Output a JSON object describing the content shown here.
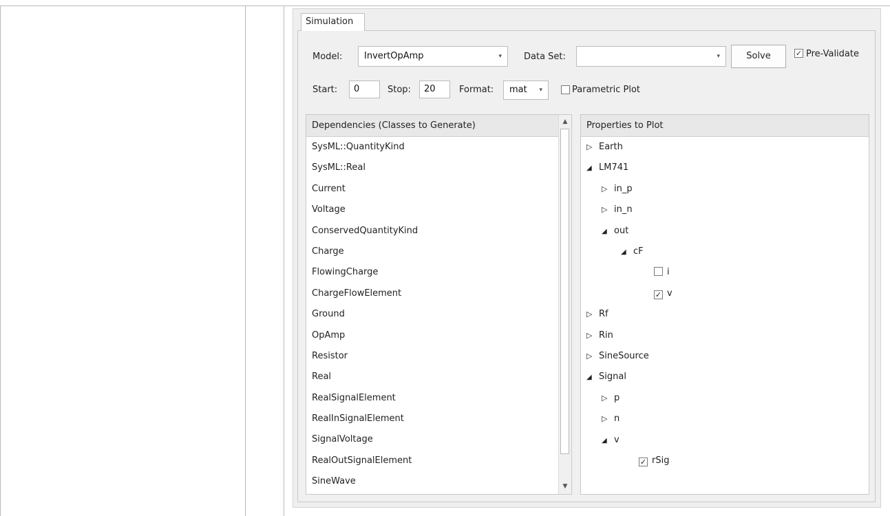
{
  "tab": {
    "label": "Simulation"
  },
  "model": {
    "label": "Model:",
    "value": "InvertOpAmp"
  },
  "dataset": {
    "label": "Data Set:",
    "value": ""
  },
  "solve_label": "Solve",
  "prevalidate": {
    "label": "Pre-Validate",
    "checked": true
  },
  "start": {
    "label": "Start:",
    "value": "0"
  },
  "stop": {
    "label": "Stop:",
    "value": "20"
  },
  "format": {
    "label": "Format:",
    "value": "mat"
  },
  "parametric": {
    "label": "Parametric Plot",
    "checked": false
  },
  "dependencies": {
    "header": "Dependencies (Classes to Generate)",
    "items": [
      "SysML::QuantityKind",
      "SysML::Real",
      "Current",
      "Voltage",
      "ConservedQuantityKind",
      "Charge",
      "FlowingCharge",
      "ChargeFlowElement",
      "Ground",
      "OpAmp",
      "Resistor",
      "Real",
      "RealSignalElement",
      "RealInSignalElement",
      "SignalVoltage",
      "RealOutSignalElement",
      "SineWave"
    ]
  },
  "properties": {
    "header": "Properties to Plot",
    "items": [
      {
        "label": "Earth",
        "state": "collapsed",
        "checked": null
      },
      {
        "label": "LM741",
        "state": "expanded",
        "checked": null
      },
      {
        "label": "in_p",
        "state": "collapsed",
        "checked": null
      },
      {
        "label": "in_n",
        "state": "collapsed",
        "checked": null
      },
      {
        "label": "out",
        "state": "expanded",
        "checked": null
      },
      {
        "label": "cF",
        "state": "expanded",
        "checked": null
      },
      {
        "label": "i",
        "state": "leaf",
        "checked": false
      },
      {
        "label": "v",
        "state": "leaf",
        "checked": true
      },
      {
        "label": "Rf",
        "state": "collapsed",
        "checked": null
      },
      {
        "label": "Rin",
        "state": "collapsed",
        "checked": null
      },
      {
        "label": "SineSource",
        "state": "collapsed",
        "checked": null
      },
      {
        "label": "Signal",
        "state": "expanded",
        "checked": null
      },
      {
        "label": "p",
        "state": "collapsed",
        "checked": null
      },
      {
        "label": "n",
        "state": "collapsed",
        "checked": null
      },
      {
        "label": "v",
        "state": "expanded",
        "checked": null
      },
      {
        "label": "rSig",
        "state": "leaf",
        "checked": true
      }
    ]
  },
  "icons": {
    "collapsed": "▷",
    "expanded": "◢",
    "check": "✓",
    "dropdown": "▾",
    "scroll_up": "▲",
    "scroll_down": "▼"
  }
}
